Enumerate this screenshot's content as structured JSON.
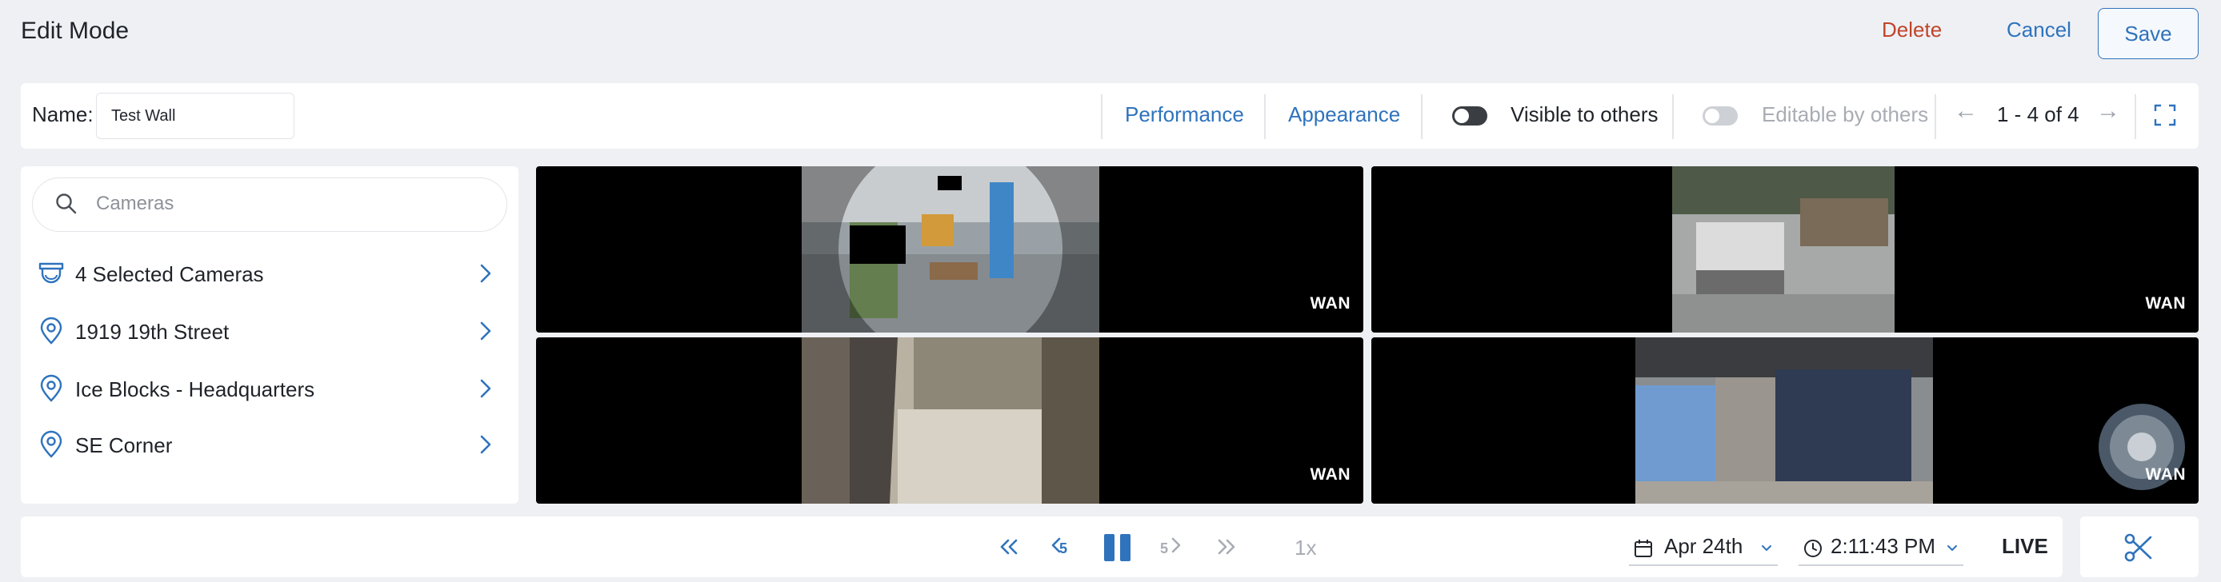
{
  "header": {
    "title": "Edit Mode",
    "delete_label": "Delete",
    "cancel_label": "Cancel",
    "save_label": "Save"
  },
  "toolbar": {
    "name_label": "Name:",
    "name_value": "Test Wall",
    "performance_label": "Performance",
    "appearance_label": "Appearance",
    "visible_label": "Visible to others",
    "visible_on": true,
    "editable_label": "Editable by others",
    "editable_on": false,
    "pager_text": "1 - 4 of 4",
    "prev_icon": "arrow-left-icon",
    "next_icon": "arrow-right-icon",
    "fullscreen_icon": "fullscreen-icon"
  },
  "sidebar": {
    "search_placeholder": "Cameras",
    "items": [
      {
        "label": "4 Selected Cameras",
        "icon": "camera-dome-icon"
      },
      {
        "label": "1919 19th Street",
        "icon": "location-pin-icon"
      },
      {
        "label": "Ice Blocks - Headquarters",
        "icon": "location-pin-icon"
      },
      {
        "label": "SE Corner",
        "icon": "location-pin-icon"
      }
    ]
  },
  "cameras": [
    {
      "badge": "WAN"
    },
    {
      "badge": "WAN"
    },
    {
      "badge": "WAN"
    },
    {
      "badge": "WAN"
    }
  ],
  "playback": {
    "skip_back_step": "5",
    "skip_forward_step": "5",
    "speed": "1x",
    "date": "Apr 24th",
    "time": "2:11:43 PM",
    "live_label": "LIVE"
  },
  "colors": {
    "accent": "#2f73bd",
    "danger": "#c0452a",
    "background": "#eef0f4",
    "panel": "#ffffff"
  }
}
